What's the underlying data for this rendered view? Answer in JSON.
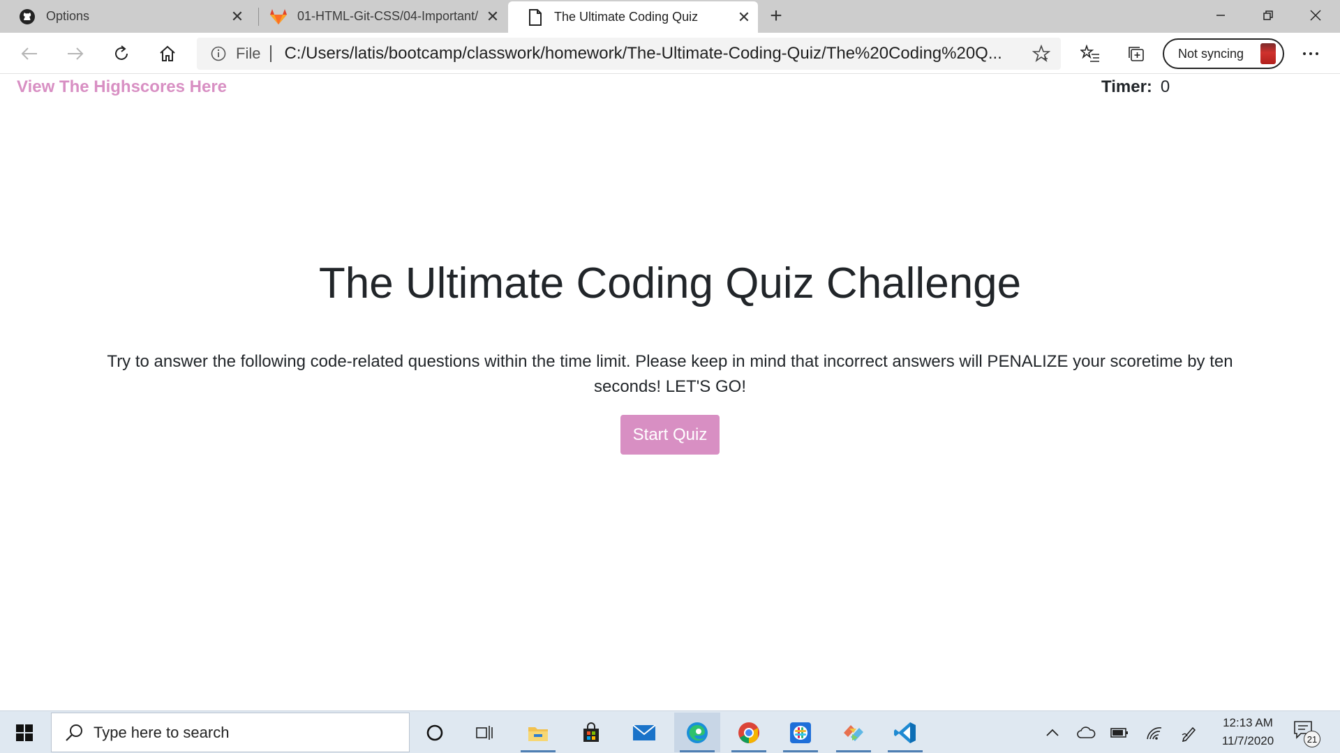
{
  "browser": {
    "tabs": [
      {
        "title": "Options",
        "icon": "github-icon"
      },
      {
        "title": "01-HTML-Git-CSS/04-Important/",
        "icon": "gitlab-icon"
      },
      {
        "title": "The Ultimate Coding Quiz",
        "icon": "document-icon",
        "active": true
      }
    ],
    "address": {
      "scheme": "File",
      "url": "C:/Users/latis/bootcamp/classwork/homework/The-Ultimate-Coding-Quiz/The%20Coding%20Q..."
    },
    "sync_label": "Not syncing"
  },
  "page": {
    "highscores_link": "View The Highscores Here",
    "timer_label": "Timer:",
    "timer_value": "0",
    "title": "The Ultimate Coding Quiz Challenge",
    "description": "Try to answer the following code-related questions within the time limit. Please keep in mind that incorrect answers will PENALIZE your scoretime by ten seconds! LET'S GO!",
    "start_button": "Start Quiz",
    "accent_color": "#d88fc3"
  },
  "taskbar": {
    "search_placeholder": "Type here to search",
    "time": "12:13 AM",
    "date": "11/7/2020",
    "notification_count": "21"
  }
}
